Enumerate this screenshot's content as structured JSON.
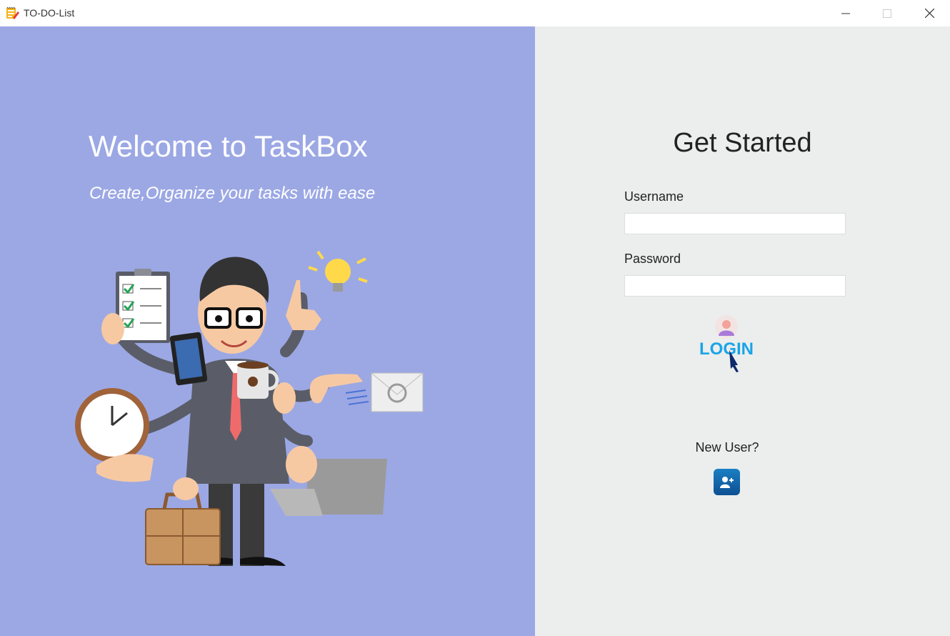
{
  "window": {
    "title": "TO-DO-List",
    "icon": "notepad-pencil-icon",
    "controls": [
      "minimize-icon",
      "maximize-icon",
      "close-icon"
    ]
  },
  "welcome": {
    "title": "Welcome to TaskBox",
    "tagline": "Create,Organize your tasks with ease",
    "illustration": "multitasking-businessman-illustration",
    "background_color": "#9ca8e4"
  },
  "login_panel": {
    "heading": "Get Started",
    "username_label": "Username",
    "username_value": "",
    "password_label": "Password",
    "password_value": "",
    "login_button_text": "LOGIN",
    "new_user_label": "New User?",
    "add_user_icon": "add-user-icon",
    "background_color": "#ebeeed",
    "accent_color": "#1aa4e8"
  }
}
